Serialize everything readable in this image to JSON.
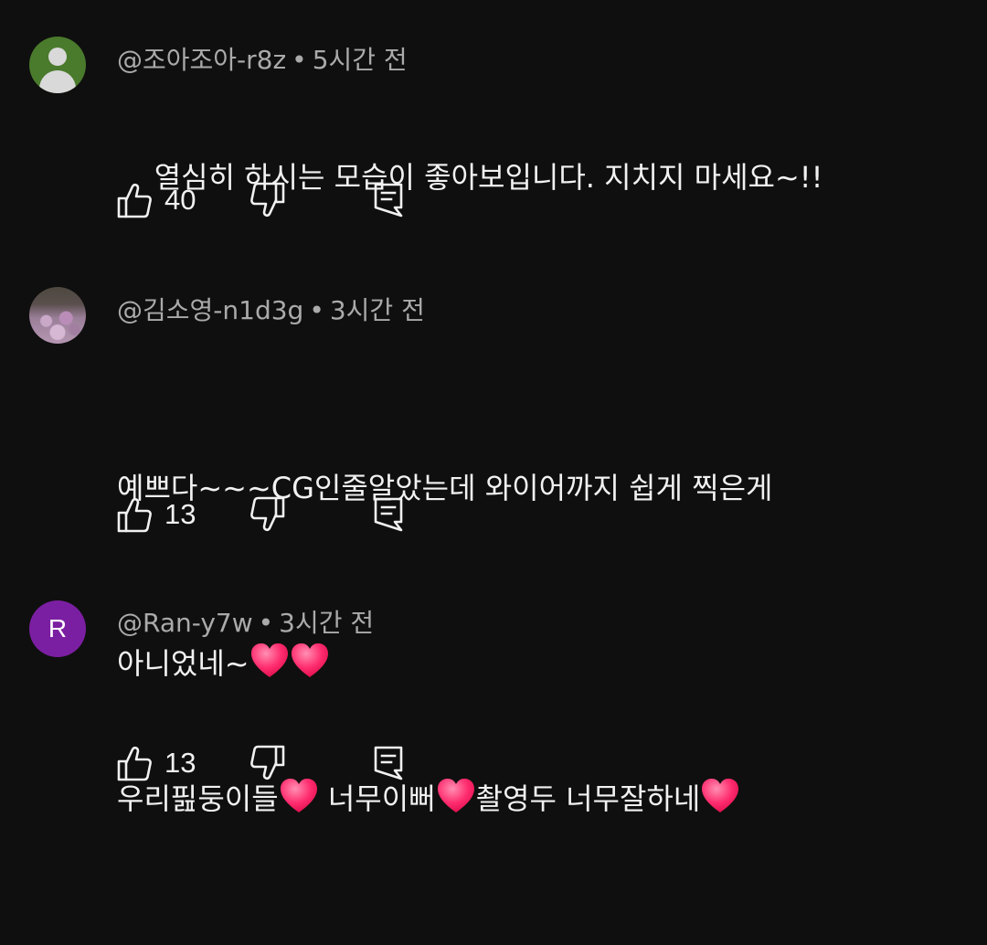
{
  "comments": [
    {
      "author": "@조아조아-r8z",
      "time": "5시간 전",
      "lines": [
        "열심히 하시는 모습이 좋아보입니다. 지치지 마세요~!!"
      ],
      "likes": "40",
      "avatar_icon": "default-user-icon"
    },
    {
      "author": "@김소영-n1d3g",
      "time": "3시간 전",
      "lines": [
        "예쁘다~~~CG인줄알았는데 와이어까지 쉽게 찍은게",
        "아니었네~"
      ],
      "likes": "13",
      "avatar_icon": "profile-photo"
    },
    {
      "author": "@Ran-y7w",
      "time": "3시간 전",
      "segments": [
        "우리핊둥이들",
        " 너무이뻐",
        "촬영두 너무잘하네"
      ],
      "likes": "13",
      "avatar_letter": "R"
    }
  ],
  "separator": "•",
  "colors": {
    "background": "#0f0f0f",
    "text_primary": "#f1f1f1",
    "text_secondary": "#aaaaaa",
    "heart": "#ff2d6f",
    "avatar_purple": "#7b1fa2",
    "avatar_green": "#4a7a2c"
  }
}
